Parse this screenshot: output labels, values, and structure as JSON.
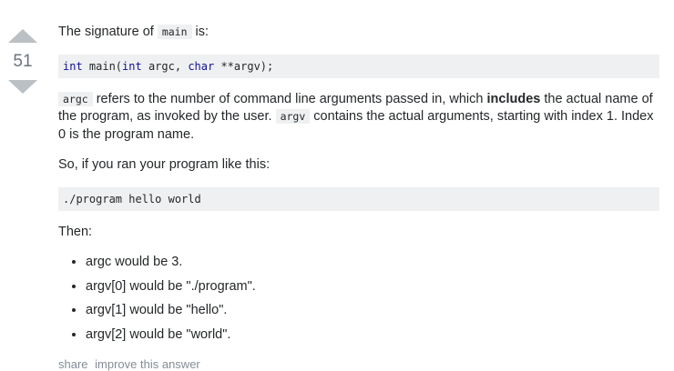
{
  "vote": {
    "count": "51"
  },
  "answer": {
    "intro_prefix": "The signature of ",
    "intro_code": "main",
    "intro_suffix": " is:",
    "sig_kw1": "int",
    "sig_fn": " main(",
    "sig_kw2": "int",
    "sig_argc": " argc, ",
    "sig_kw3": "char",
    "sig_rest": " **argv);",
    "para2_code1": "argc",
    "para2_text1": " refers to the number of command line arguments passed in, which ",
    "para2_bold": "includes",
    "para2_text2": " the actual name of the program, as invoked by the user. ",
    "para2_code2": "argv",
    "para2_text3": " contains the actual arguments, starting with index 1. Index 0 is the program name.",
    "para3": "So, if you ran your program like this:",
    "command": "./program hello world",
    "then_label": "Then:",
    "bullets": [
      "argc would be 3.",
      "argv[0] would be \"./program\".",
      "argv[1] would be \"hello\".",
      "argv[2] would be \"world\"."
    ]
  },
  "menu": {
    "share": "share",
    "improve": "improve this answer"
  }
}
